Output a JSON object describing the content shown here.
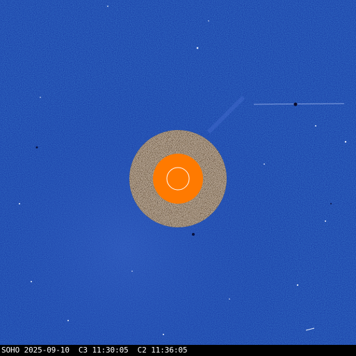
{
  "image": {
    "caption": "SOHO 2025-09-10  C3 11:30:05  C2 11:36:05",
    "colors": {
      "background_blue": "#1a3fa8",
      "occulter_orange": "#ff7a00",
      "sun_circle": "#ffffff",
      "caption_bar": "#000000",
      "caption_text": "#ffffff"
    },
    "icons": {
      "sun_disk": "sun-outline-icon"
    }
  }
}
